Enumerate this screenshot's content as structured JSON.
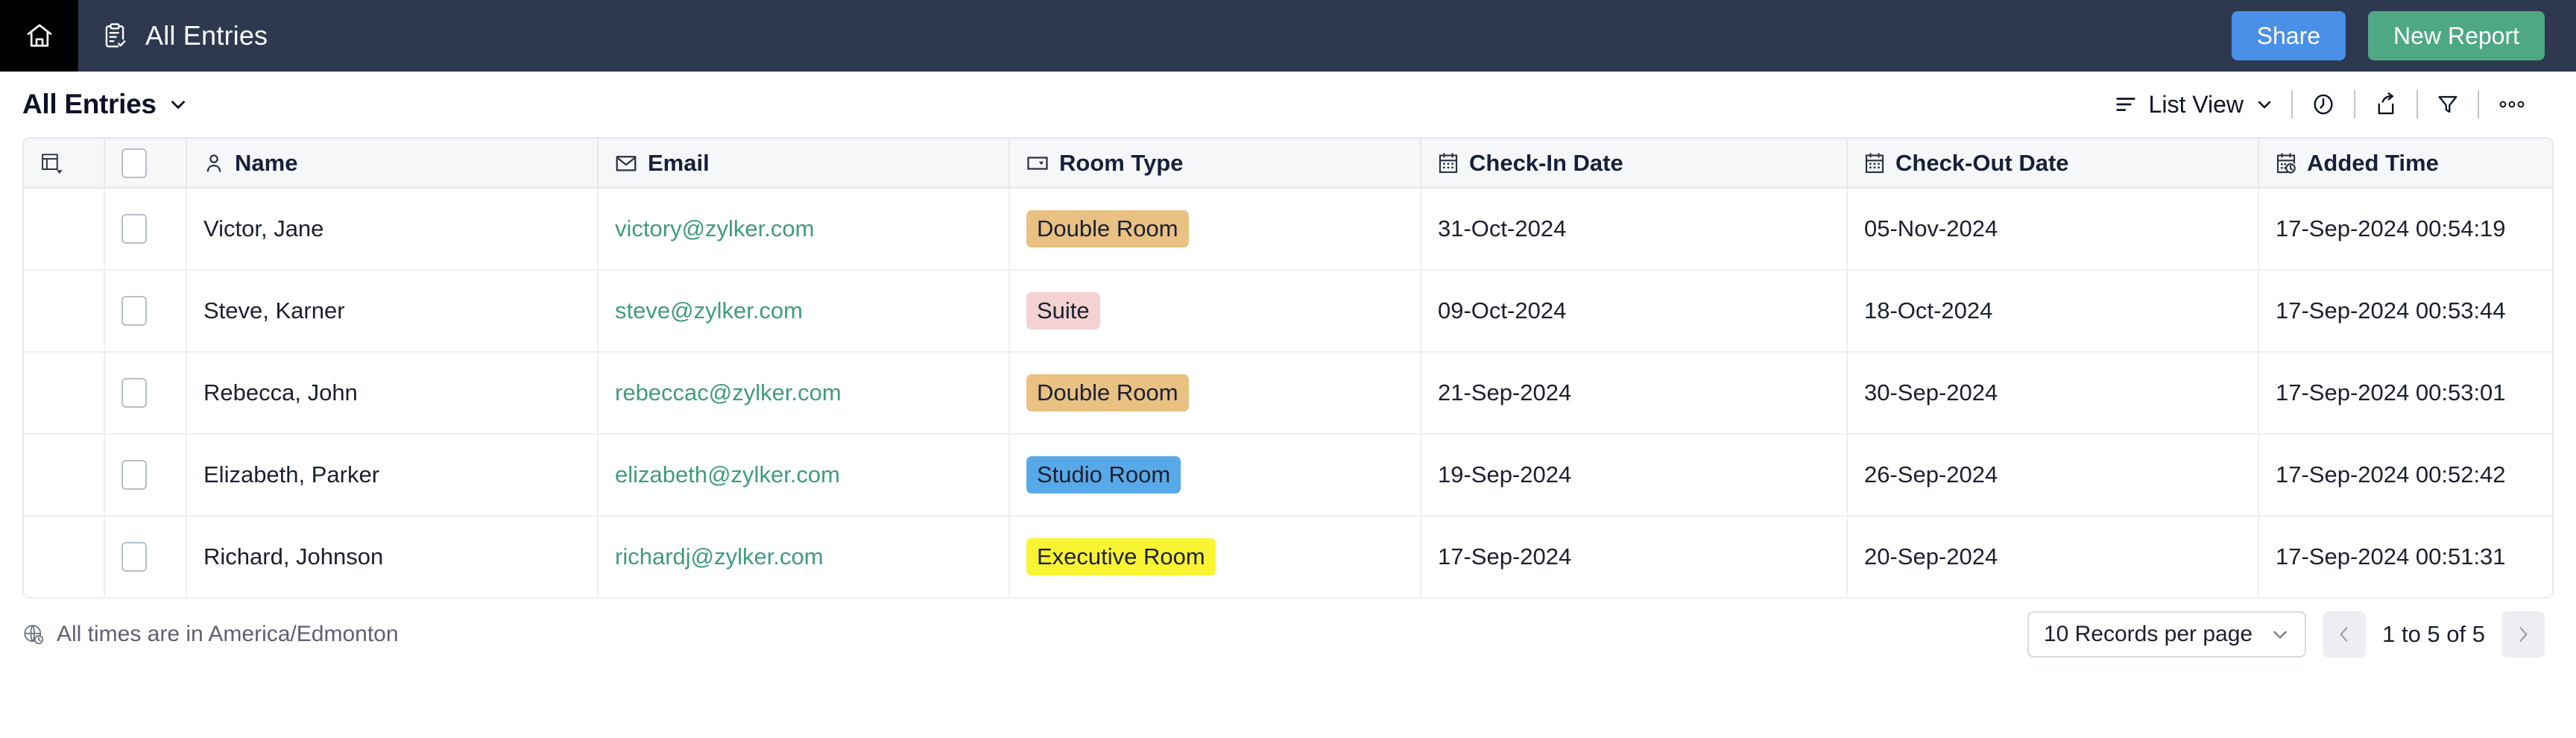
{
  "topnav": {
    "home_icon": "home-icon",
    "app_icon": "clipboard-check-icon",
    "title": "All Entries",
    "share_label": "Share",
    "new_report_label": "New Report",
    "colors": {
      "bar_bg": "#2e3950",
      "home_bg": "#000000",
      "share_bg": "#4a90e8",
      "new_report_bg": "#4fa884"
    }
  },
  "toolbar": {
    "view_name": "All Entries",
    "view_name_caret": "chevron-down-icon",
    "view_mode_icon": "list-view-icon",
    "view_mode_label": "List View",
    "view_mode_caret": "chevron-down-icon",
    "history_icon": "clock-icon",
    "export_icon": "share-export-icon",
    "filter_icon": "filter-funnel-icon",
    "more_icon": "more-horizontal-icon"
  },
  "table": {
    "columns": [
      {
        "key": "handle",
        "label": "",
        "icon": "column-settings-icon"
      },
      {
        "key": "select",
        "label": "",
        "icon": "checkbox-icon"
      },
      {
        "key": "name",
        "label": "Name",
        "icon": "person-icon"
      },
      {
        "key": "email",
        "label": "Email",
        "icon": "envelope-icon"
      },
      {
        "key": "room",
        "label": "Room Type",
        "icon": "dropdown-field-icon"
      },
      {
        "key": "checkin",
        "label": "Check-In Date",
        "icon": "calendar-icon"
      },
      {
        "key": "checkout",
        "label": "Check-Out Date",
        "icon": "calendar-icon"
      },
      {
        "key": "added",
        "label": "Added Time",
        "icon": "calendar-clock-icon"
      }
    ],
    "rows": [
      {
        "name": "Victor, Jane",
        "email": "victory@zylker.com",
        "room": "Double Room",
        "room_color": "#e8c183",
        "checkin": "31-Oct-2024",
        "checkout": "05-Nov-2024",
        "added": "17-Sep-2024 00:54:19"
      },
      {
        "name": "Steve, Karner",
        "email": "steve@zylker.com",
        "room": "Suite",
        "room_color": "#f4d2d2",
        "checkin": "09-Oct-2024",
        "checkout": "18-Oct-2024",
        "added": "17-Sep-2024 00:53:44"
      },
      {
        "name": "Rebecca, John",
        "email": "rebeccac@zylker.com",
        "room": "Double Room",
        "room_color": "#e8c183",
        "checkin": "21-Sep-2024",
        "checkout": "30-Sep-2024",
        "added": "17-Sep-2024 00:53:01"
      },
      {
        "name": "Elizabeth, Parker",
        "email": "elizabeth@zylker.com",
        "room": "Studio Room",
        "room_color": "#58a9e8",
        "checkin": "19-Sep-2024",
        "checkout": "26-Sep-2024",
        "added": "17-Sep-2024 00:52:42"
      },
      {
        "name": "Richard, Johnson",
        "email": "richardj@zylker.com",
        "room": "Executive Room",
        "room_color": "#f9f431",
        "checkin": "17-Sep-2024",
        "checkout": "20-Sep-2024",
        "added": "17-Sep-2024 00:51:31"
      }
    ]
  },
  "footer": {
    "timezone_icon": "globe-clock-icon",
    "timezone_note": "All times are in America/Edmonton",
    "per_page_label": "10 Records per page",
    "per_page_caret": "chevron-down-icon",
    "prev_icon": "chevron-left-icon",
    "next_icon": "chevron-right-icon",
    "range_label": "1 to 5 of 5"
  },
  "colors": {
    "email_link": "#3f9d78",
    "header_bg": "#f5f7f9",
    "border": "#e3e8ee"
  }
}
